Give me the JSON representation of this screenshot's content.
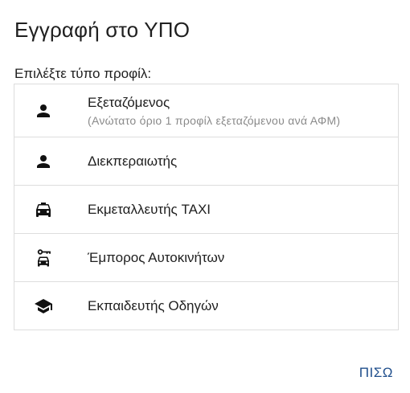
{
  "dialog": {
    "title": "Εγγραφή στο ΥΠΟ",
    "subtitle": "Επιλέξτε τύπο προφίλ:",
    "back_label": "ΠΙΣΩ"
  },
  "profiles": [
    {
      "label": "Εξεταζόμενος",
      "hint": "(Ανώτατο όριο 1 προφίλ εξεταζόμενου ανά ΑΦΜ)",
      "icon": "person-icon"
    },
    {
      "label": "Διεκπεραιωτής",
      "icon": "person-icon"
    },
    {
      "label": "Εκμεταλλευτής TAXI",
      "icon": "taxi-icon"
    },
    {
      "label": "Έμπορος Αυτοκινήτων",
      "icon": "car-dealer-icon"
    },
    {
      "label": "Εκπαιδευτής Οδηγών",
      "icon": "graduation-cap-icon"
    }
  ],
  "colors": {
    "accent": "#1f4e8c",
    "hint": "#8a8a8a",
    "border": "#dddddd"
  }
}
